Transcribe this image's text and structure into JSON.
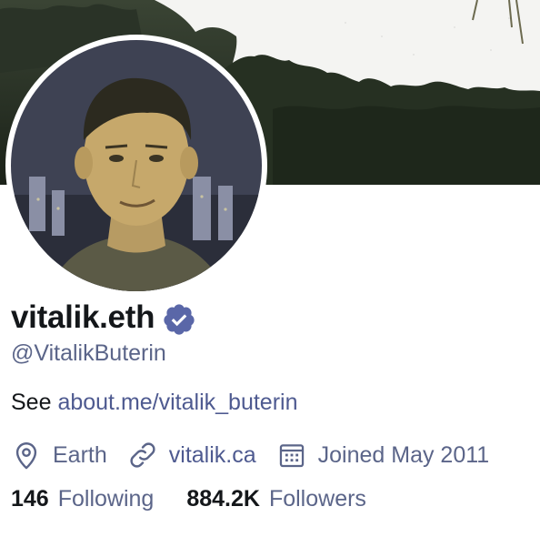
{
  "profile": {
    "display_name": "vitalik.eth",
    "handle": "@VitalikButerin",
    "verified_icon": "verified-badge-icon",
    "bio": {
      "prefix": "See ",
      "link_text": "about.me/vitalik_buterin"
    },
    "meta": {
      "location": "Earth",
      "location_icon": "location-pin-icon",
      "website": "vitalik.ca",
      "website_icon": "link-icon",
      "joined": "Joined May 2011",
      "joined_icon": "calendar-icon"
    },
    "stats": {
      "following_count": "146",
      "following_label": "Following",
      "followers_count": "884.2K",
      "followers_label": "Followers"
    }
  },
  "colors": {
    "name": "#14171a",
    "muted": "#5b6589",
    "link": "#4e5a90",
    "verified": "#5a67a8",
    "background": "#ffffff"
  }
}
